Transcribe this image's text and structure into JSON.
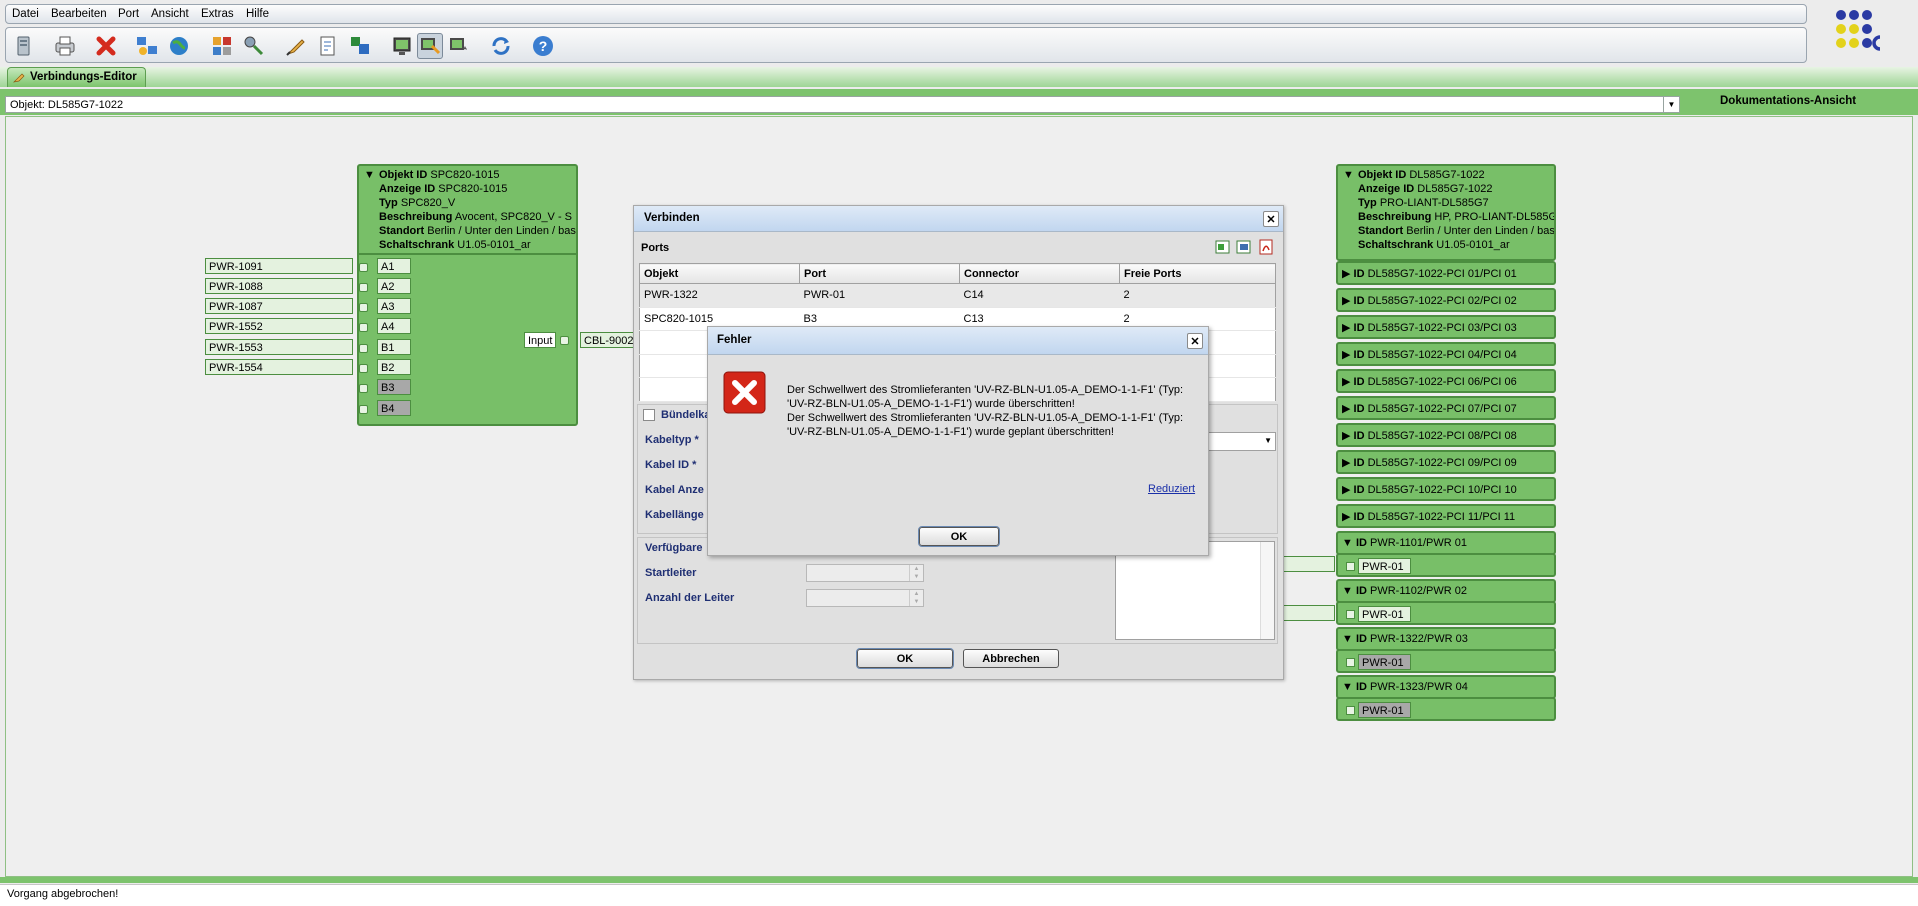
{
  "menu": [
    "Datei",
    "Bearbeiten",
    "Port",
    "Ansicht",
    "Extras",
    "Hilfe"
  ],
  "toolbar_icons": [
    "server-icon",
    "print-icon",
    "delete-icon",
    "network-icon",
    "globe-icon",
    "grid-icon",
    "route-icon",
    "edit-icon",
    "document-icon",
    "cubes-icon",
    "monitor-icon",
    "connect-icon",
    "star-connect-icon",
    "refresh-icon",
    "help-icon"
  ],
  "tab": {
    "label": "Verbindungs-Editor"
  },
  "object_selector": {
    "value": "Objekt: DL585G7-1022"
  },
  "doc_view_label": "Dokumentations-Ansicht",
  "left_card": {
    "fields": [
      {
        "key": "Objekt ID",
        "value": "SPC820-1015"
      },
      {
        "key": "Anzeige ID",
        "value": "SPC820-1015"
      },
      {
        "key": "Typ",
        "value": "SPC820_V"
      },
      {
        "key": "Beschreibung",
        "value": "Avocent, SPC820_V - S"
      },
      {
        "key": "Standort",
        "value": "Berlin / Unter den Linden / bas"
      },
      {
        "key": "Schaltschrank",
        "value": "U1.05-0101_ar"
      }
    ],
    "ports": [
      "A1",
      "A2",
      "A3",
      "A4",
      "B1",
      "B2",
      "B3",
      "B4"
    ],
    "pwr_links": [
      "PWR-1091",
      "PWR-1088",
      "PWR-1087",
      "PWR-1552",
      "PWR-1553",
      "PWR-1554"
    ],
    "input_label": "Input",
    "cable_label": "CBL-9002"
  },
  "right_card": {
    "fields": [
      {
        "key": "Objekt ID",
        "value": "DL585G7-1022"
      },
      {
        "key": "Anzeige ID",
        "value": "DL585G7-1022"
      },
      {
        "key": "Typ",
        "value": "PRO-LIANT-DL585G7"
      },
      {
        "key": "Beschreibung",
        "value": "HP, PRO-LIANT-DL585G"
      },
      {
        "key": "Standort",
        "value": "Berlin / Unter den Linden / bas"
      },
      {
        "key": "Schaltschrank",
        "value": "U1.05-0101_ar"
      }
    ],
    "id_label": "ID",
    "pci_rows": [
      "DL585G7-1022-PCI 01/PCI 01",
      "DL585G7-1022-PCI 02/PCI 02",
      "DL585G7-1022-PCI 03/PCI 03",
      "DL585G7-1022-PCI 04/PCI 04",
      "DL585G7-1022-PCI 06/PCI 06",
      "DL585G7-1022-PCI 07/PCI 07",
      "DL585G7-1022-PCI 08/PCI 08",
      "DL585G7-1022-PCI 09/PCI 09",
      "DL585G7-1022-PCI 10/PCI 10",
      "DL585G7-1022-PCI 11/PCI 11"
    ],
    "pwr_groups": [
      {
        "id": "PWR-1101/PWR 01",
        "port": "PWR-01"
      },
      {
        "id": "PWR-1102/PWR 02",
        "port": "PWR-01"
      },
      {
        "id": "PWR-1322/PWR 03",
        "port": "PWR-01"
      },
      {
        "id": "PWR-1323/PWR 04",
        "port": "PWR-01"
      }
    ]
  },
  "connect_dialog": {
    "title": "Verbinden",
    "ports_label": "Ports",
    "columns": [
      "Objekt",
      "Port",
      "Connector",
      "Freie Ports"
    ],
    "rows": [
      [
        "PWR-1322",
        "PWR-01",
        "C14",
        "2"
      ],
      [
        "SPC820-1015",
        "B3",
        "C13",
        "2"
      ]
    ],
    "bundle_label": "Bündelka",
    "fields": [
      "Kabeltyp *",
      "Kabel ID *",
      "Kabel Anze",
      "Kabellänge"
    ],
    "available_label": "Verfügbare",
    "start_label": "Startleiter",
    "count_label": "Anzahl der Leiter",
    "ok": "OK",
    "cancel": "Abbrechen"
  },
  "error_dialog": {
    "title": "Fehler",
    "message_1": "Der Schwellwert des Stromlieferanten 'UV-RZ-BLN-U1.05-A_DEMO-1-1-F1' (Typ: 'UV-RZ-BLN-U1.05-A_DEMO-1-1-F1') wurde überschritten!",
    "message_2": "Der Schwellwert des Stromlieferanten 'UV-RZ-BLN-U1.05-A_DEMO-1-1-F1' (Typ: 'UV-RZ-BLN-U1.05-A_DEMO-1-1-F1') wurde geplant überschritten!",
    "detail_link": "Reduziert",
    "ok": "OK"
  },
  "status": "Vorgang abgebrochen!"
}
